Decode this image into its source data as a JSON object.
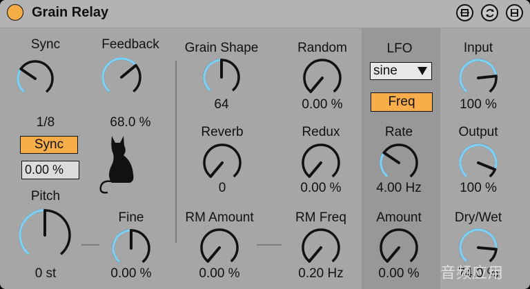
{
  "device": {
    "title": "Grain Relay",
    "power_color": "#f5ad45",
    "accent_color": "#7ed0f5",
    "buttons": [
      "hot-swap-icon",
      "refresh-icon",
      "save-icon"
    ]
  },
  "knobs": {
    "sync": {
      "label": "Sync",
      "value": "1/8",
      "fraction": 0.3
    },
    "feedback": {
      "label": "Feedback",
      "value": "68.0 %",
      "fraction": 0.68
    },
    "pitch": {
      "label": "Pitch",
      "value": "0 st",
      "fraction": 0.5
    },
    "fine": {
      "label": "Fine",
      "value": "0.00 %",
      "fraction": 0.5
    },
    "grain_shape": {
      "label": "Grain Shape",
      "value": "64",
      "fraction": 0.5
    },
    "random": {
      "label": "Random",
      "value": "0.00 %",
      "fraction": 0.0
    },
    "reverb": {
      "label": "Reverb",
      "value": "0",
      "fraction": 0.0
    },
    "redux": {
      "label": "Redux",
      "value": "0.00 %",
      "fraction": 0.0
    },
    "rm_amount": {
      "label": "RM Amount",
      "value": "0.00 %",
      "fraction": 0.0
    },
    "rm_freq": {
      "label": "RM Freq",
      "value": "0.20 Hz",
      "fraction": 0.0
    },
    "rate": {
      "label": "Rate",
      "value": "4.00 Hz",
      "fraction": 0.3
    },
    "amount": {
      "label": "Amount",
      "value": "0.00 %",
      "fraction": 0.0
    },
    "input": {
      "label": "Input",
      "value": "100 %",
      "fraction": 0.8
    },
    "output": {
      "label": "Output",
      "value": "100 %",
      "fraction": 0.9
    },
    "dry_wet": {
      "label": "Dry/Wet",
      "value": "74.0 %",
      "fraction": 0.84
    }
  },
  "sync_button": {
    "label": "Sync"
  },
  "sync_numbox": {
    "value": "0.00 %"
  },
  "lfo": {
    "label": "LFO",
    "waveform": "sine",
    "freq_button": "Freq"
  },
  "watermark": "音频应用"
}
